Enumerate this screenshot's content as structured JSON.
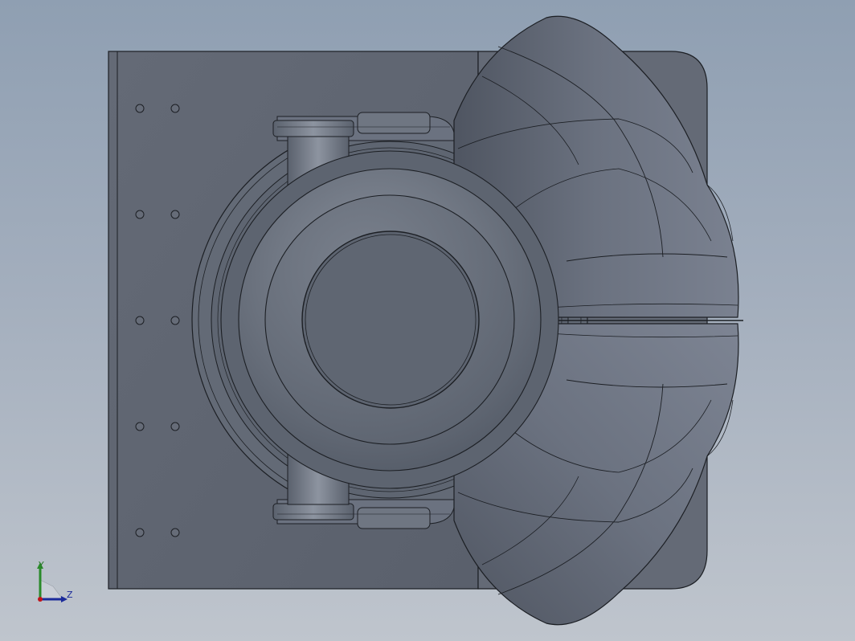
{
  "viewport": {
    "background_top": "#8f9fb2",
    "background_bottom": "#bfc5cd",
    "model_fill": "#5f6673",
    "model_edge": "#1c1f24"
  },
  "triad": {
    "y_label": "Y",
    "z_label": "Z",
    "y_color": "#2a8a2a",
    "z_color": "#1a2a9a",
    "origin_color": "#c0141a"
  }
}
